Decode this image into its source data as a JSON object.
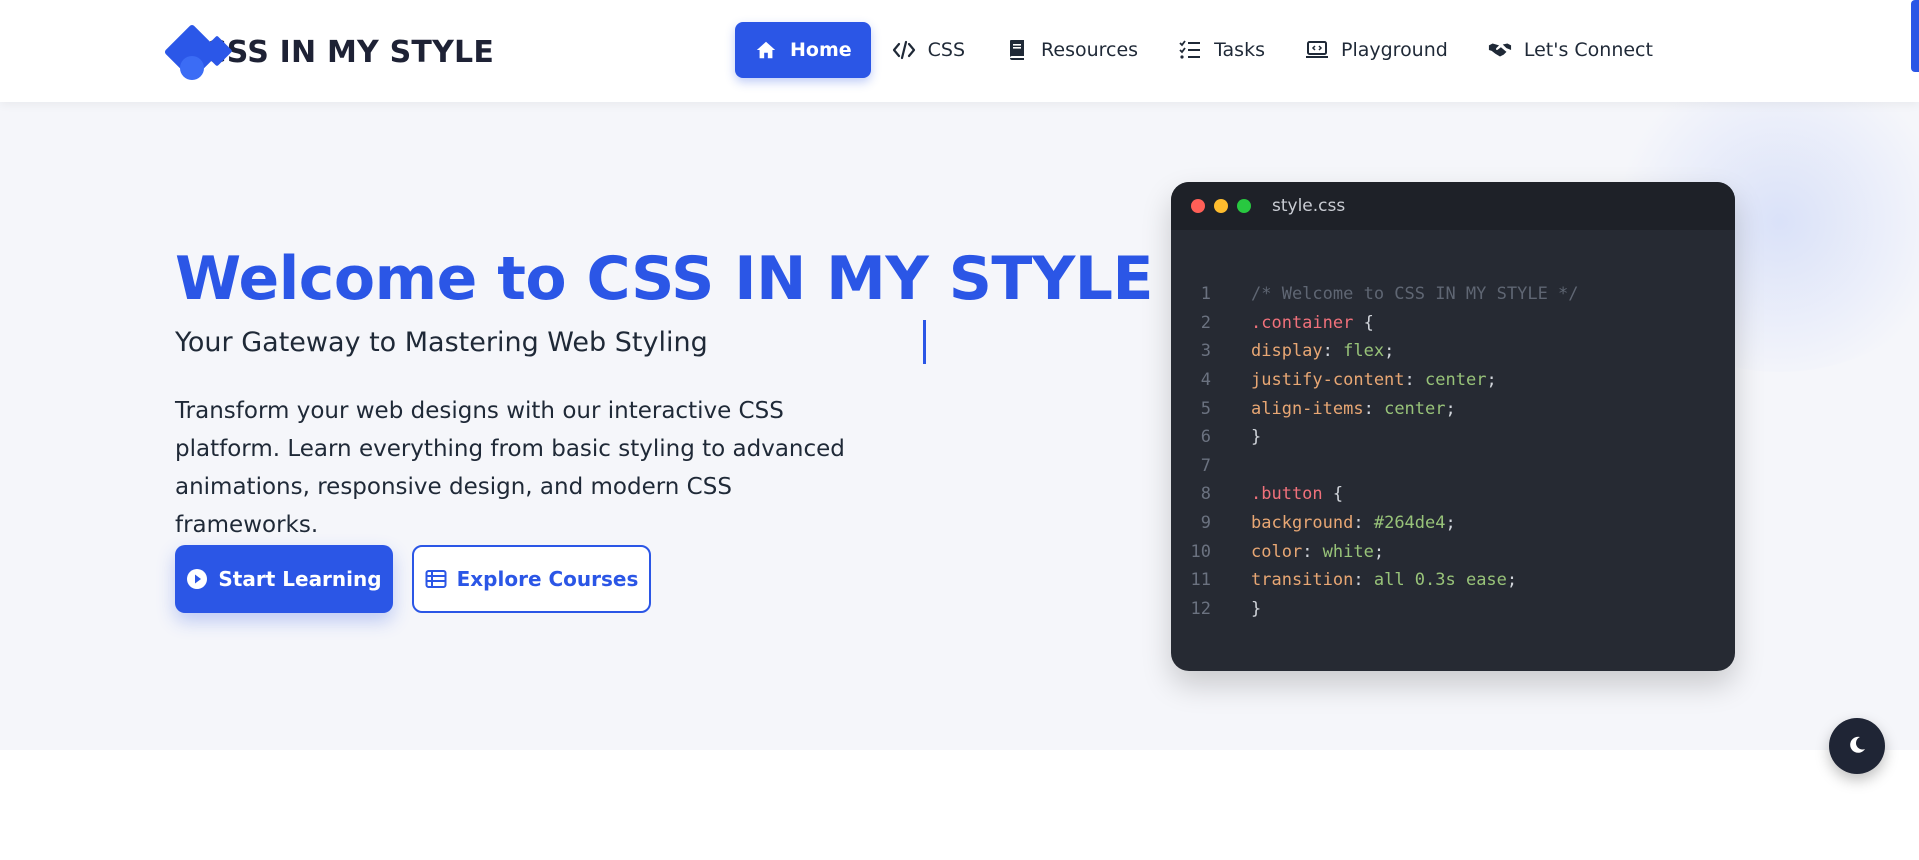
{
  "brand": {
    "name": "CSS IN MY STYLE"
  },
  "nav": {
    "items": [
      {
        "label": "Home",
        "icon": "home-icon",
        "active": true
      },
      {
        "label": "CSS",
        "icon": "code-icon",
        "active": false
      },
      {
        "label": "Resources",
        "icon": "book-icon",
        "active": false
      },
      {
        "label": "Tasks",
        "icon": "checklist-icon",
        "active": false
      },
      {
        "label": "Playground",
        "icon": "laptop-code-icon",
        "active": false
      },
      {
        "label": "Let's Connect",
        "icon": "handshake-icon",
        "active": false
      }
    ]
  },
  "hero": {
    "title": "Welcome to CSS IN MY STYLE",
    "subtitle": "Your Gateway to Mastering Web Styling",
    "description": "Transform your web designs with our interactive CSS platform. Learn everything from basic styling to advanced animations, responsive design, and modern CSS frameworks.",
    "primary_button": "Start Learning",
    "secondary_button": "Explore Courses"
  },
  "code_window": {
    "filename": "style.css",
    "lines": [
      {
        "n": "1",
        "tokens": [
          [
            "c-comment",
            "/* Welcome to CSS IN MY STYLE */"
          ]
        ]
      },
      {
        "n": "2",
        "tokens": [
          [
            "c-sel",
            ".container"
          ],
          [
            "c-punc",
            " {"
          ]
        ]
      },
      {
        "n": "3",
        "tokens": [
          [
            "c-prop",
            "display"
          ],
          [
            "c-punc",
            ": "
          ],
          [
            "c-val",
            "flex"
          ],
          [
            "c-punc",
            ";"
          ]
        ]
      },
      {
        "n": "4",
        "tokens": [
          [
            "c-prop",
            "justify-content"
          ],
          [
            "c-punc",
            ": "
          ],
          [
            "c-val",
            "center"
          ],
          [
            "c-punc",
            ";"
          ]
        ]
      },
      {
        "n": "5",
        "tokens": [
          [
            "c-prop",
            "align-items"
          ],
          [
            "c-punc",
            ": "
          ],
          [
            "c-val",
            "center"
          ],
          [
            "c-punc",
            ";"
          ]
        ]
      },
      {
        "n": "6",
        "tokens": [
          [
            "c-punc",
            "}"
          ]
        ]
      },
      {
        "n": "7",
        "tokens": []
      },
      {
        "n": "8",
        "tokens": [
          [
            "c-sel",
            ".button"
          ],
          [
            "c-punc",
            " {"
          ]
        ]
      },
      {
        "n": "9",
        "tokens": [
          [
            "c-prop",
            "background"
          ],
          [
            "c-punc",
            ": "
          ],
          [
            "c-val",
            "#264de4"
          ],
          [
            "c-punc",
            ";"
          ]
        ]
      },
      {
        "n": "10",
        "tokens": [
          [
            "c-prop",
            "color"
          ],
          [
            "c-punc",
            ": "
          ],
          [
            "c-val",
            "white"
          ],
          [
            "c-punc",
            ";"
          ]
        ]
      },
      {
        "n": "11",
        "tokens": [
          [
            "c-prop",
            "transition"
          ],
          [
            "c-punc",
            ": "
          ],
          [
            "c-val",
            "all 0.3s ease"
          ],
          [
            "c-punc",
            ";"
          ]
        ]
      },
      {
        "n": "12",
        "tokens": [
          [
            "c-punc",
            "}"
          ]
        ]
      }
    ]
  },
  "theme_toggle": {
    "icon": "moon-icon"
  },
  "colors": {
    "accent": "#2b56e6",
    "hero_bg": "#f5f6fa",
    "code_bg": "#262a33",
    "code_header_bg": "#1e2128",
    "toggle_bg": "#1f2535"
  }
}
